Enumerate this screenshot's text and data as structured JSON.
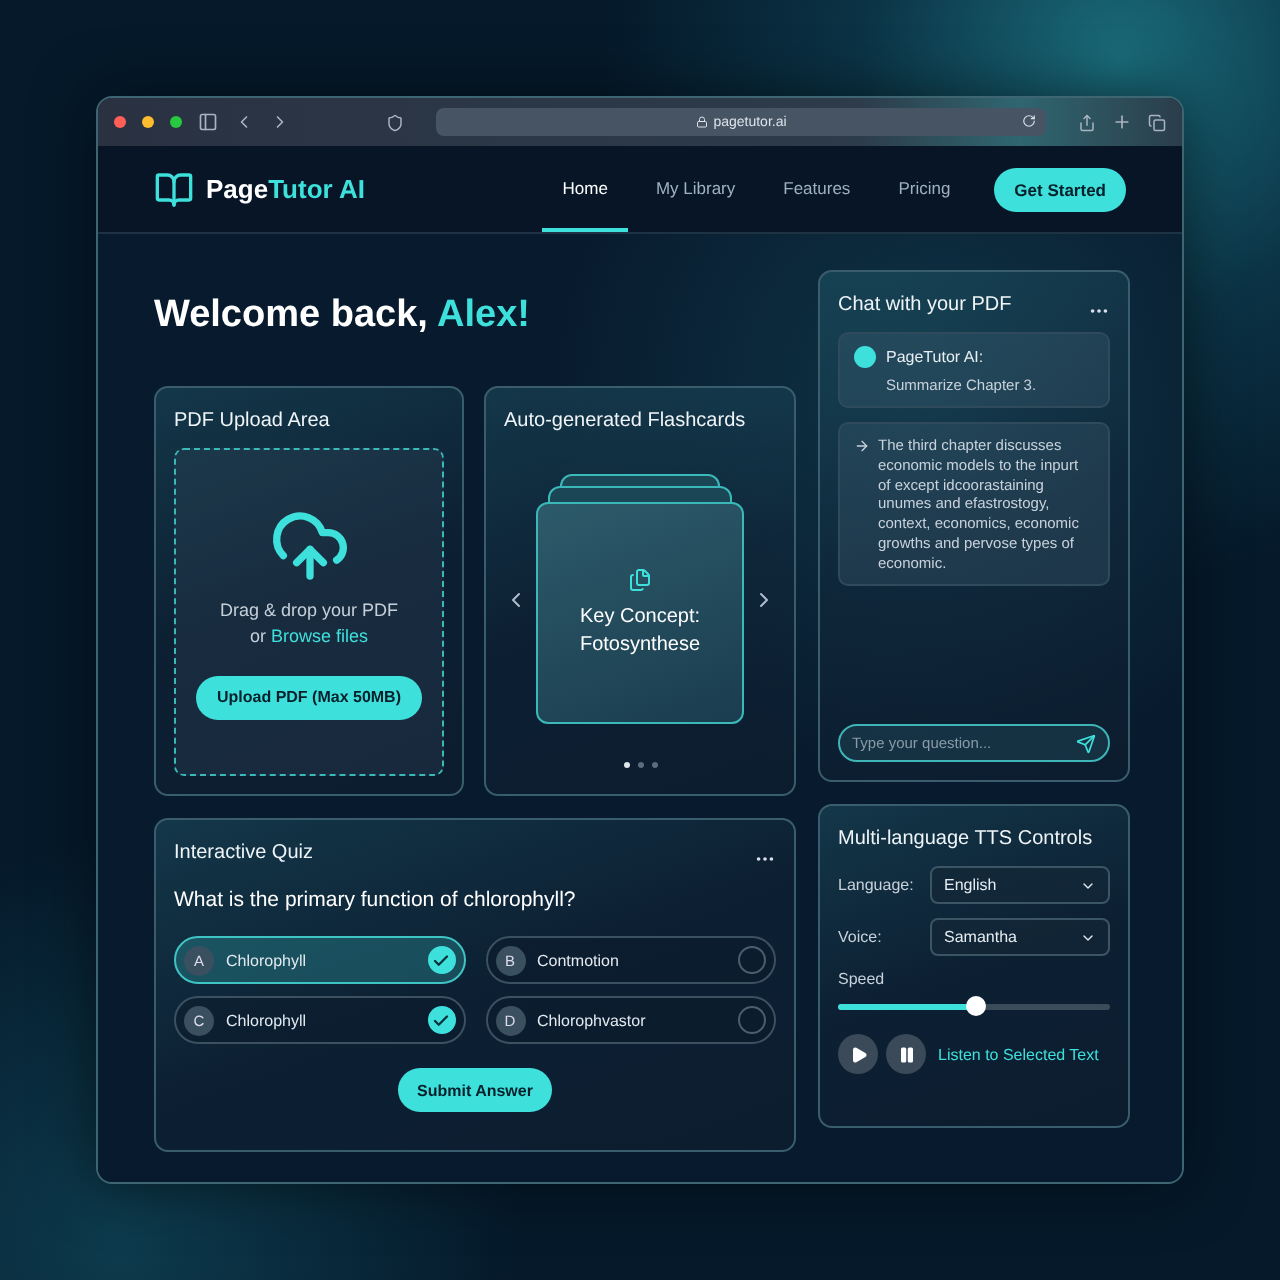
{
  "browser": {
    "url": "pagetutor.ai"
  },
  "brand": {
    "first": "Page",
    "second": "Tutor AI"
  },
  "nav": [
    {
      "label": "Home",
      "selected": true
    },
    {
      "label": "My Library",
      "selected": false
    },
    {
      "label": "Features",
      "selected": false
    },
    {
      "label": "Pricing",
      "selected": false
    }
  ],
  "cta": "Get Started",
  "welcome": {
    "greeting": "Welcome back, ",
    "name": "Alex!"
  },
  "upload": {
    "title": "PDF Upload Area",
    "line1": "Drag & drop your PDF",
    "line2": "or ",
    "link": "Browse files",
    "button": "Upload PDF (Max 50MB)"
  },
  "flashcards": {
    "title": "Auto-generated Flashcards",
    "card": "Key Concept: Fotosynthese",
    "dots": [
      {
        "selected": true
      },
      {
        "selected": false
      },
      {
        "selected": false
      }
    ]
  },
  "quiz": {
    "title": "Interactive Quiz",
    "question": "What is the primary function of chlorophyll?",
    "submit": "Submit Answer",
    "options": [
      {
        "letter": "A",
        "text": "Chlorophyll",
        "selected": true,
        "checked": true
      },
      {
        "letter": "B",
        "text": "Contmotion",
        "selected": false,
        "checked": false
      },
      {
        "letter": "C",
        "text": "Chlorophyll",
        "selected": false,
        "checked": true
      },
      {
        "letter": "D",
        "text": "Chlorophvastor",
        "selected": false,
        "checked": false
      }
    ]
  },
  "chat": {
    "title": "Chat with your PDF",
    "sender": "PageTutor AI:",
    "prompt": "Summarize Chapter 3.",
    "answer": "The third chapter discusses economic models to the inpurt of except idcoorastaining unumes and efastrostogy, context, economics, economic growths and pervose types of economic.",
    "placeholder": "Type your question..."
  },
  "tts": {
    "title": "Multi-language TTS Controls",
    "language_label": "Language:",
    "language": "English",
    "voice_label": "Voice:",
    "voice": "Samantha",
    "speed_label": "Speed",
    "speed": {
      "level": 0.51
    },
    "listen": "Listen to Selected Text"
  }
}
